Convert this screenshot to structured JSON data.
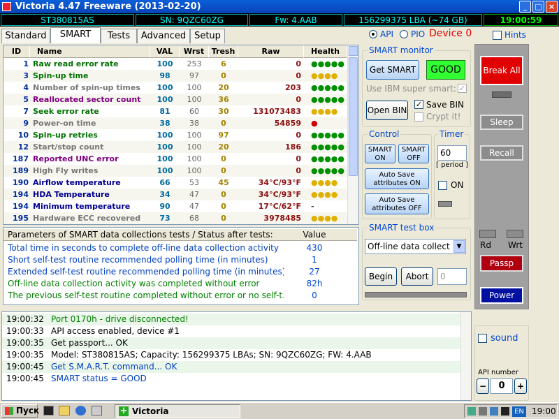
{
  "window": {
    "title": "Victoria 4.47  Freeware (2013-02-20)",
    "min_label": "_",
    "max_label": "□",
    "close_label": "×"
  },
  "info_bar": {
    "model": "ST380815AS",
    "serial": "SN: 9QZC60ZG",
    "firmware": "Fw: 4.AAB",
    "lba": "156299375 LBA (~74 GB)",
    "time": "19:00:59"
  },
  "tabs": [
    "Standard",
    "SMART",
    "Tests",
    "Advanced",
    "Setup"
  ],
  "active_tab": "SMART",
  "mode": {
    "api_label": "API",
    "pio_label": "PIO",
    "selected": "API",
    "device": "Device 0"
  },
  "hints": {
    "label": "Hints",
    "checked": false
  },
  "smart_table": {
    "columns": [
      "ID",
      "Name",
      "VAL",
      "Wrst",
      "Tresh",
      "Raw",
      "Health"
    ],
    "rows": [
      {
        "id": "1",
        "name": "Raw read error rate",
        "val": "100",
        "wrst": "253",
        "tresh": "6",
        "raw": "0",
        "health": "●●●●●",
        "name_color": "#007000",
        "health_color": "#009000"
      },
      {
        "id": "3",
        "name": "Spin-up time",
        "val": "98",
        "wrst": "97",
        "tresh": "0",
        "raw": "0",
        "health": "●●●●",
        "name_color": "#007000",
        "health_color": "#e0b000"
      },
      {
        "id": "4",
        "name": "Number of spin-up times",
        "val": "100",
        "wrst": "100",
        "tresh": "20",
        "raw": "203",
        "health": "●●●●●",
        "name_color": "#777777",
        "health_color": "#009000"
      },
      {
        "id": "5",
        "name": "Reallocated sector count",
        "val": "100",
        "wrst": "100",
        "tresh": "36",
        "raw": "0",
        "health": "●●●●●",
        "name_color": "#800080",
        "health_color": "#009000"
      },
      {
        "id": "7",
        "name": "Seek error rate",
        "val": "81",
        "wrst": "60",
        "tresh": "30",
        "raw": "131073483",
        "health": "●●●●",
        "name_color": "#007000",
        "health_color": "#e0b000"
      },
      {
        "id": "9",
        "name": "Power-on time",
        "val": "38",
        "wrst": "38",
        "tresh": "0",
        "raw": "54859",
        "health": "●",
        "name_color": "#777777",
        "health_color": "#d00000"
      },
      {
        "id": "10",
        "name": "Spin-up retries",
        "val": "100",
        "wrst": "100",
        "tresh": "97",
        "raw": "0",
        "health": "●●●●●",
        "name_color": "#007000",
        "health_color": "#009000"
      },
      {
        "id": "12",
        "name": "Start/stop count",
        "val": "100",
        "wrst": "100",
        "tresh": "20",
        "raw": "186",
        "health": "●●●●●",
        "name_color": "#777777",
        "health_color": "#009000"
      },
      {
        "id": "187",
        "name": "Reported UNC error",
        "val": "100",
        "wrst": "100",
        "tresh": "0",
        "raw": "0",
        "health": "●●●●●",
        "name_color": "#800080",
        "health_color": "#009000"
      },
      {
        "id": "189",
        "name": "High Fly writes",
        "val": "100",
        "wrst": "100",
        "tresh": "0",
        "raw": "0",
        "health": "●●●●●",
        "name_color": "#777777",
        "health_color": "#009000"
      },
      {
        "id": "190",
        "name": "Airflow temperature",
        "val": "66",
        "wrst": "53",
        "tresh": "45",
        "raw": "34°C/93°F",
        "health": "●●●●",
        "name_color": "#000090",
        "health_color": "#e0b000"
      },
      {
        "id": "194",
        "name": "HDA Temperature",
        "val": "34",
        "wrst": "47",
        "tresh": "0",
        "raw": "34°C/93°F",
        "health": "●●●●",
        "name_color": "#000090",
        "health_color": "#e0b000"
      },
      {
        "id": "194",
        "name": "Minimum temperature",
        "val": "90",
        "wrst": "47",
        "tresh": "0",
        "raw": "17°C/62°F",
        "health": "-",
        "name_color": "#000090",
        "health_color": "#444444"
      },
      {
        "id": "195",
        "name": "Hardware ECC recovered",
        "val": "73",
        "wrst": "68",
        "tresh": "0",
        "raw": "3978485",
        "health": "●●●●",
        "name_color": "#777777",
        "health_color": "#e0b000"
      }
    ]
  },
  "params": {
    "header_label": "Parameters of SMART data collections tests / Status after tests:",
    "header_value": "Value",
    "rows": [
      {
        "label": "Total time in seconds to complete off-line data collection activity",
        "value": "430",
        "color": "#0040c0"
      },
      {
        "label": "Short self-test routine recommended polling time (in minutes)",
        "value": "1",
        "color": "#0040c0"
      },
      {
        "label": "Extended self-test routine recommended polling time (in minutes)",
        "value": "27",
        "color": "#0040c0"
      },
      {
        "label": "Off-line data collection activity was completed without error",
        "value": "82h",
        "color": "#008000"
      },
      {
        "label": "The previous self-test routine completed without error or no self-t...",
        "value": "0",
        "color": "#008000"
      }
    ]
  },
  "smart_monitor": {
    "title": "SMART monitor",
    "get_smart": "Get SMART",
    "status": "GOOD",
    "ibm_label": "Use IBM super smart:",
    "ibm_checked": true,
    "open_bin": "Open BIN",
    "save_bin_label": "Save BIN",
    "save_bin_checked": true,
    "crypt_label": "Crypt it!",
    "crypt_checked": false
  },
  "control": {
    "title": "Control",
    "smart_on": "SMART ON",
    "smart_off": "SMART OFF",
    "autosave_on": "Auto Save attributes ON",
    "autosave_off": "Auto Save attributes OFF"
  },
  "timer": {
    "title": "Timer",
    "value": "60",
    "period_label": "[ period ]",
    "on_label": "ON",
    "on_checked": false
  },
  "test_box": {
    "title": "SMART test box",
    "selected": "Off-line data collect",
    "begin": "Begin",
    "abort": "Abort",
    "value": "0"
  },
  "log": [
    {
      "time": "19:00:32",
      "msg": "Port 0170h - drive disconnected!",
      "color": "#008000"
    },
    {
      "time": "19:00:33",
      "msg": "API access enabled, device #1",
      "color": "#000000"
    },
    {
      "time": "19:00:35",
      "msg": "Get passport... OK",
      "color": "#000000"
    },
    {
      "time": "19:00:35",
      "msg": "Model: ST380815AS; Capacity: 156299375 LBAs; SN: 9QZC60ZG; FW: 4.AAB",
      "color": "#000000"
    },
    {
      "time": "19:00:45",
      "msg": "Get S.M.A.R.T. command... OK",
      "color": "#0040c0"
    },
    {
      "time": "19:00:45",
      "msg": "SMART status = GOOD",
      "color": "#0040c0"
    }
  ],
  "right_panel": {
    "break_all": "Break All",
    "sleep": "Sleep",
    "recall": "Recall",
    "rd_label": "Rd",
    "wrt_label": "Wrt",
    "passp": "Passp",
    "power": "Power"
  },
  "sound": {
    "label": "sound",
    "checked": false
  },
  "api_number": {
    "label": "API number",
    "minus": "−",
    "value": "0",
    "plus": "+"
  },
  "taskbar": {
    "start": "Пуск",
    "app": "Victoria",
    "lang": "EN",
    "clock": "19:00"
  }
}
